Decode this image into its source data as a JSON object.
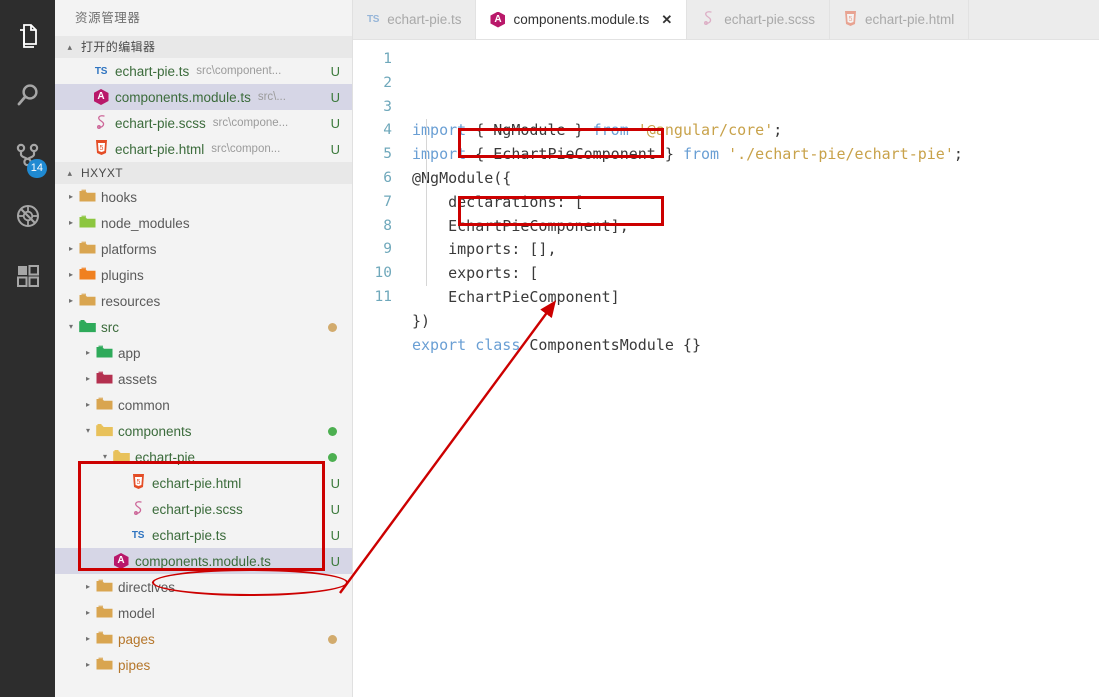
{
  "activity_bar": {
    "items": [
      {
        "name": "explorer-icon",
        "label": "Explorer",
        "active": true
      },
      {
        "name": "search-icon",
        "label": "Search",
        "active": false
      },
      {
        "name": "source-control-icon",
        "label": "Source Control",
        "active": false,
        "badge": "14"
      },
      {
        "name": "debug-icon",
        "label": "Run and Debug",
        "active": false
      },
      {
        "name": "extensions-icon",
        "label": "Extensions",
        "active": false
      }
    ]
  },
  "sidebar": {
    "title": "资源管理器",
    "open_editors": {
      "header": "打开的编辑器",
      "twisty": "▴",
      "items": [
        {
          "icon": "ts-icon",
          "name": "echart-pie.ts",
          "path": "src\\component...",
          "status": "U",
          "selected": false
        },
        {
          "icon": "angular-icon",
          "name": "components.module.ts",
          "path": "src\\...",
          "status": "U",
          "selected": true
        },
        {
          "icon": "scss-icon",
          "name": "echart-pie.scss",
          "path": "src\\compone...",
          "status": "U",
          "selected": false
        },
        {
          "icon": "html-icon",
          "name": "echart-pie.html",
          "path": "src\\compon...",
          "status": "U",
          "selected": false
        }
      ]
    },
    "project": {
      "header": "HXYXT",
      "twisty": "▴",
      "tree": [
        {
          "label": "hooks",
          "type": "folder",
          "depth": 1,
          "expanded": false,
          "color": "gray",
          "folder_color": "#d9a550",
          "dot": null
        },
        {
          "label": "node_modules",
          "type": "folder",
          "depth": 1,
          "expanded": false,
          "color": "gray",
          "folder_color": "#8cc63f",
          "dot": null
        },
        {
          "label": "platforms",
          "type": "folder",
          "depth": 1,
          "expanded": false,
          "color": "gray",
          "folder_color": "#d9a550",
          "dot": null
        },
        {
          "label": "plugins",
          "type": "folder",
          "depth": 1,
          "expanded": false,
          "color": "gray",
          "folder_color": "#f08020",
          "dot": null
        },
        {
          "label": "resources",
          "type": "folder",
          "depth": 1,
          "expanded": false,
          "color": "gray",
          "folder_color": "#d9a550",
          "dot": null
        },
        {
          "label": "src",
          "type": "folder",
          "depth": 1,
          "expanded": true,
          "color": "green",
          "folder_color": "#2eaa5a",
          "dot": "#d2ab6d"
        },
        {
          "label": "app",
          "type": "folder",
          "depth": 2,
          "expanded": false,
          "color": "gray",
          "folder_color": "#2eaa5a",
          "dot": null
        },
        {
          "label": "assets",
          "type": "folder",
          "depth": 2,
          "expanded": false,
          "color": "gray",
          "folder_color": "#b4304f",
          "dot": null
        },
        {
          "label": "common",
          "type": "folder",
          "depth": 2,
          "expanded": false,
          "color": "gray",
          "folder_color": "#d9a550",
          "dot": null
        },
        {
          "label": "components",
          "type": "folder",
          "depth": 2,
          "expanded": true,
          "color": "green",
          "folder_color": "#e8c15a",
          "dot": "#4caf50"
        },
        {
          "label": "echart-pie",
          "type": "folder",
          "depth": 3,
          "expanded": true,
          "color": "green",
          "folder_color": "#e8c15a",
          "dot": "#4caf50"
        },
        {
          "label": "echart-pie.html",
          "type": "file",
          "depth": 4,
          "icon": "html-icon",
          "color": "green",
          "status": "U"
        },
        {
          "label": "echart-pie.scss",
          "type": "file",
          "depth": 4,
          "icon": "scss-icon",
          "color": "green",
          "status": "U"
        },
        {
          "label": "echart-pie.ts",
          "type": "file",
          "depth": 4,
          "icon": "ts-icon",
          "color": "green",
          "status": "U"
        },
        {
          "label": "components.module.ts",
          "type": "file",
          "depth": 3,
          "icon": "angular-icon",
          "color": "green",
          "status": "U",
          "selected": true
        },
        {
          "label": "directives",
          "type": "folder",
          "depth": 2,
          "expanded": false,
          "color": "gray",
          "folder_color": "#d9a550",
          "dot": null
        },
        {
          "label": "model",
          "type": "folder",
          "depth": 2,
          "expanded": false,
          "color": "gray",
          "folder_color": "#d9a550",
          "dot": null
        },
        {
          "label": "pages",
          "type": "folder",
          "depth": 2,
          "expanded": false,
          "color": "orange",
          "folder_color": "#d9a550",
          "dot": "#d2ab6d"
        },
        {
          "label": "pipes",
          "type": "folder",
          "depth": 2,
          "expanded": false,
          "color": "orange",
          "folder_color": "#d9a550",
          "dot": null
        }
      ]
    }
  },
  "editor": {
    "tabs": [
      {
        "icon": "ts-icon",
        "label": "echart-pie.ts",
        "active": false,
        "closable": false
      },
      {
        "icon": "angular-icon",
        "label": "components.module.ts",
        "active": true,
        "closable": true,
        "close_glyph": "✕"
      },
      {
        "icon": "scss-icon",
        "label": "echart-pie.scss",
        "active": false,
        "closable": false
      },
      {
        "icon": "html-icon",
        "label": "echart-pie.html",
        "active": false,
        "closable": false
      }
    ],
    "line_numbers": [
      "1",
      "2",
      "3",
      "4",
      "5",
      "6",
      "7",
      "8",
      "9",
      "10",
      "11"
    ],
    "code_lines": [
      [
        {
          "t": "import",
          "c": "kw"
        },
        {
          "t": " { NgModule } ",
          "c": "plain"
        },
        {
          "t": "from",
          "c": "kw"
        },
        {
          "t": " ",
          "c": "plain"
        },
        {
          "t": "'@angular/core'",
          "c": "str"
        },
        {
          "t": ";",
          "c": "plain"
        }
      ],
      [
        {
          "t": "import",
          "c": "kw"
        },
        {
          "t": " { EchartPieComponent } ",
          "c": "plain"
        },
        {
          "t": "from",
          "c": "kw"
        },
        {
          "t": " ",
          "c": "plain"
        },
        {
          "t": "'./echart-pie/echart-pie'",
          "c": "str"
        },
        {
          "t": ";",
          "c": "plain"
        }
      ],
      [
        {
          "t": "@NgModule({",
          "c": "plain"
        }
      ],
      [
        {
          "t": "    declarations: [",
          "c": "plain"
        }
      ],
      [
        {
          "t": "    EchartPieComponent],",
          "c": "plain"
        }
      ],
      [
        {
          "t": "    imports: [],",
          "c": "plain"
        }
      ],
      [
        {
          "t": "    exports: [",
          "c": "plain"
        }
      ],
      [
        {
          "t": "    EchartPieComponent]",
          "c": "plain"
        }
      ],
      [
        {
          "t": "})",
          "c": "plain"
        }
      ],
      [
        {
          "t": "export",
          "c": "kw"
        },
        {
          "t": " ",
          "c": "plain"
        },
        {
          "t": "class",
          "c": "kw"
        },
        {
          "t": " ComponentsModule {}",
          "c": "plain"
        }
      ],
      [
        {
          "t": "",
          "c": "plain"
        }
      ]
    ]
  },
  "annotations": {
    "color": "#cc0000",
    "rect_code_declarations": {
      "label": "red-box-around-declarations-EchartPieComponent"
    },
    "rect_code_exports": {
      "label": "red-box-around-exports-EchartPieComponent"
    },
    "rect_tree_echart_pie": {
      "label": "red-box-around-echart-pie-folder"
    },
    "ellipse_components_module": {
      "label": "red-ellipse-around-components-module-ts"
    },
    "arrow": {
      "label": "red-arrow-from-components-module-to-code"
    }
  }
}
